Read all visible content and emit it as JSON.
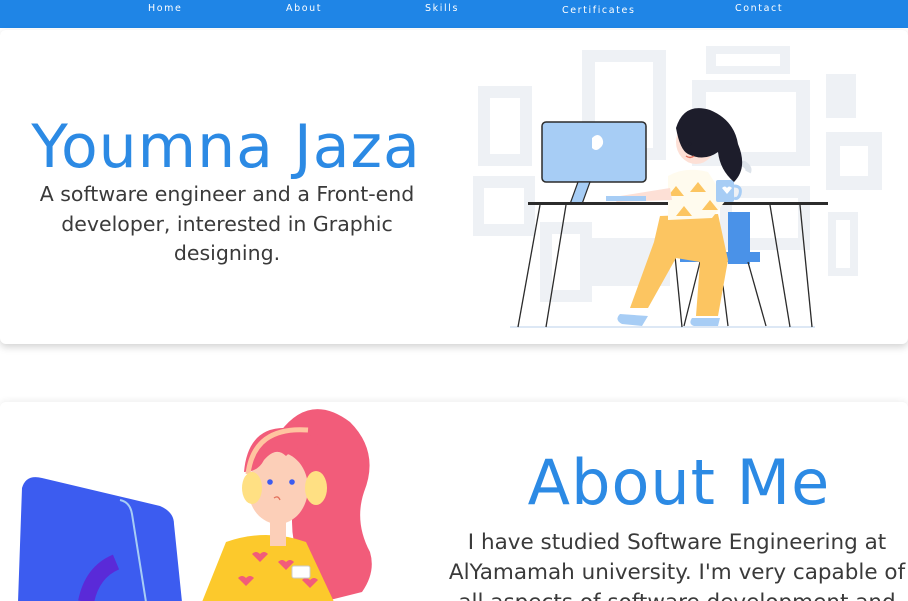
{
  "nav": {
    "home": "Home",
    "about": "About",
    "skills": "Skills",
    "certificates": "Certificates",
    "contact": "Contact"
  },
  "hero": {
    "name": "Youmna Jaza",
    "tagline": "A software engineer and a Front-end developer, interested in Graphic designing."
  },
  "about": {
    "title": "About Me",
    "body": "I have studied Software Engineering at AlYamamah university. I'm very capable of all aspects of software development and"
  },
  "colors": {
    "navbar": "#1f85e6",
    "accent": "#2c8ae4",
    "text": "#3a3a3a"
  }
}
